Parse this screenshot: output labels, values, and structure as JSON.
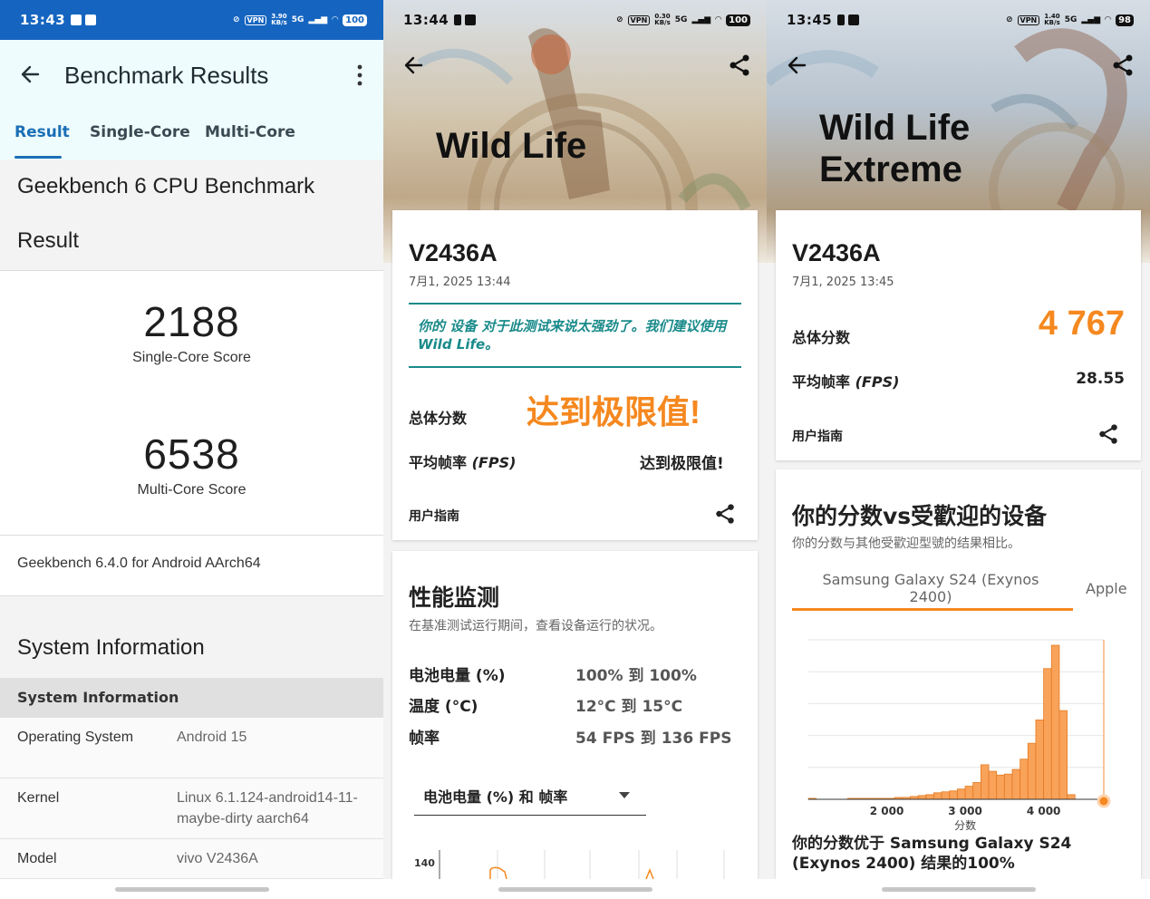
{
  "geekbench": {
    "status": {
      "time": "13:43",
      "rate": "3.90\nKB/s",
      "net": "5G",
      "vpn": "VPN",
      "battery": "100"
    },
    "header": {
      "title": "Benchmark Results"
    },
    "tabs": [
      "Result",
      "Single-Core",
      "Multi-Core"
    ],
    "card_title_line1": "Geekbench 6 CPU Benchmark",
    "card_title_line2": "Result",
    "single_core": {
      "score": "2188",
      "label": "Single-Core Score"
    },
    "multi_core": {
      "score": "6538",
      "label": "Multi-Core Score"
    },
    "version": "Geekbench 6.4.0 for Android AArch64",
    "system_section": "System Information",
    "system_header": "System Information",
    "rows": [
      {
        "key": "Operating System",
        "value": "Android 15"
      },
      {
        "key": "Kernel",
        "value": "Linux 6.1.124-android14-11-maybe-dirty aarch64"
      },
      {
        "key": "Model",
        "value": "vivo V2436A"
      }
    ]
  },
  "wildlife": {
    "status": {
      "time": "13:44",
      "rate": "0.30\nKB/s",
      "net": "5G",
      "vpn": "VPN",
      "battery": "100"
    },
    "title": "Wild Life",
    "device": "V2436A",
    "date": "7月1, 2025 13:44",
    "note": "你的 设备 对于此测试来说太强劲了。我们建议使用 Wild Life。",
    "total_score_label": "总体分数",
    "total_score_value": "达到极限值!",
    "fps_label": "平均帧率",
    "fps_label_suffix": "(FPS)",
    "fps_value": "达到极限值!",
    "guide": "用户指南",
    "monitor": {
      "title": "性能监测",
      "subtitle": "在基准测试运行期间，查看设备运行的状况。",
      "rows": [
        {
          "key": "电池电量 (%)",
          "value": "100% 到 100%"
        },
        {
          "key": "温度 (°C)",
          "value": "12°C 到 15°C"
        },
        {
          "key": "帧率",
          "value": "54 FPS 到 136 FPS"
        }
      ],
      "dropdown": "电池电量 (%) 和 帧率",
      "axis_tick": "140"
    }
  },
  "wildlife_extreme": {
    "status": {
      "time": "13:45",
      "rate": "1.40\nKB/s",
      "net": "5G",
      "vpn": "VPN",
      "battery": "98"
    },
    "title_line1": "Wild Life",
    "title_line2": "Extreme",
    "device": "V2436A",
    "date": "7月1, 2025 13:45",
    "total_score_label": "总体分数",
    "total_score_value": "4 767",
    "fps_label": "平均帧率",
    "fps_label_suffix": "(FPS)",
    "fps_value": "28.55",
    "guide": "用户指南",
    "compare": {
      "title": "你的分数vs受歡迎的设备",
      "subtitle": "你的分数与其他受歡迎型號的结果相比。",
      "tab_active": "Samsung Galaxy S24 (Exynos 2400)",
      "tab_next": "Apple",
      "xlabel": "分数",
      "summary": "你的分数优于 Samsung Galaxy S24 (Exynos 2400) 结果的100%"
    },
    "accent": "#f5881f"
  },
  "chart_data": {
    "type": "bar",
    "title": "",
    "xlabel": "分数",
    "ylabel": "",
    "x_ticks": [
      "2 000",
      "3 000",
      "4 000"
    ],
    "xlim": [
      1000,
      4767
    ],
    "bin_width": 100,
    "x": [
      1000,
      1100,
      1200,
      1300,
      1400,
      1500,
      1600,
      1700,
      1800,
      1900,
      2000,
      2100,
      2200,
      2300,
      2400,
      2500,
      2600,
      2700,
      2800,
      2900,
      3000,
      3100,
      3200,
      3300,
      3400,
      3500,
      3600,
      3700,
      3800,
      3900,
      4000,
      4100,
      4200,
      4300,
      4400
    ],
    "values": [
      1,
      0,
      0,
      0,
      0,
      1,
      1,
      1,
      1,
      1,
      1,
      2,
      2,
      3,
      4,
      5,
      7,
      8,
      9,
      11,
      14,
      18,
      37,
      30,
      26,
      27,
      32,
      43,
      60,
      85,
      140,
      165,
      95,
      5,
      0
    ],
    "marker": {
      "value": 4767,
      "label": ""
    }
  }
}
